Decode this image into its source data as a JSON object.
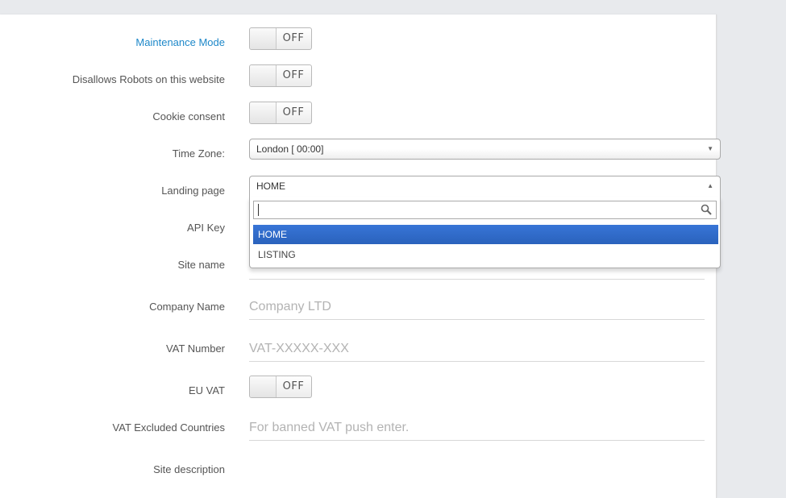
{
  "settings": {
    "maintenance_mode": {
      "label": "Maintenance Mode",
      "state": "OFF"
    },
    "disallow_robots": {
      "label": "Disallows Robots on this website",
      "state": "OFF"
    },
    "cookie_consent": {
      "label": "Cookie consent",
      "state": "OFF"
    },
    "time_zone": {
      "label": "Time Zone:",
      "value": "London [ 00:00]"
    },
    "landing_page": {
      "label": "Landing page",
      "value": "HOME",
      "search_value": "",
      "options": [
        "HOME",
        "LISTING"
      ],
      "selected_index": 0
    },
    "api_key": {
      "label": "API Key"
    },
    "site_name": {
      "label": "Site name"
    },
    "company_name": {
      "label": "Company Name",
      "placeholder": "Company LTD"
    },
    "vat_number": {
      "label": "VAT Number",
      "placeholder": "VAT-XXXXX-XXX"
    },
    "eu_vat": {
      "label": "EU VAT",
      "state": "OFF"
    },
    "vat_excluded": {
      "label": "VAT Excluded Countries",
      "placeholder": "For banned VAT push enter."
    },
    "site_description": {
      "label": "Site description"
    }
  },
  "colors": {
    "accent": "#1e88c9",
    "selected_option": "#3875d7"
  },
  "icons": {
    "search": "search-icon",
    "select_arrow": "triangle-down-icon",
    "open_arrow": "triangle-up-icon"
  }
}
